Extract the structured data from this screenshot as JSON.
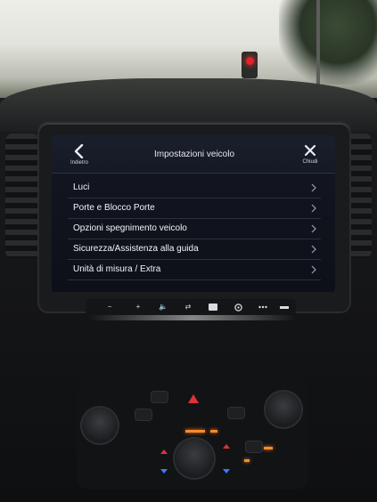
{
  "header": {
    "back_label": "Indietro",
    "title": "Impostazioni veicolo",
    "close_label": "Chiudi"
  },
  "menu": {
    "items": [
      {
        "label": "Luci"
      },
      {
        "label": "Porte e Blocco Porte"
      },
      {
        "label": "Opzioni spegnimento veicolo"
      },
      {
        "label": "Sicurezza/Assistenza alla guida"
      },
      {
        "label": "Unità di misura / Extra"
      }
    ]
  },
  "controls": {
    "minus": "−",
    "plus": "+",
    "mute": "🔈",
    "tune": "⇄"
  },
  "colors": {
    "screen_bg": "#141722",
    "text": "#f2f4f8",
    "divider": "#2b303d",
    "traffic_red": "#e2232a",
    "climate_amber": "#ff8a2a"
  }
}
